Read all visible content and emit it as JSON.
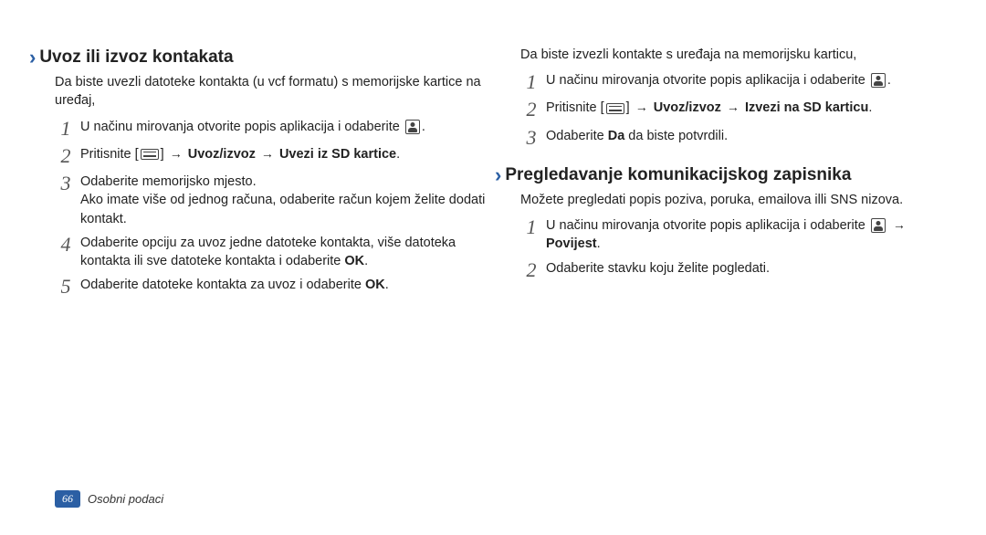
{
  "left": {
    "heading": "Uvoz ili izvoz kontakata",
    "intro": "Da biste uvezli datoteke kontakta (u vcf formatu) s memorijske kartice na uređaj,",
    "steps": [
      {
        "num": "1",
        "parts": [
          {
            "t": "U načinu mirovanja otvorite popis aplikacija i odaberite "
          },
          {
            "icon": "contact"
          },
          {
            "t": "."
          }
        ]
      },
      {
        "num": "2",
        "parts": [
          {
            "t": "Pritisnite ["
          },
          {
            "icon": "menu"
          },
          {
            "t": "] "
          },
          {
            "arrow": true
          },
          {
            "t": " "
          },
          {
            "b": "Uvoz/izvoz"
          },
          {
            "t": " "
          },
          {
            "arrow": true
          },
          {
            "t": " "
          },
          {
            "b": "Uvezi iz SD kartice"
          },
          {
            "t": "."
          }
        ]
      },
      {
        "num": "3",
        "parts": [
          {
            "t": "Odaberite memorijsko mjesto."
          }
        ],
        "sub": "Ako imate više od jednog računa, odaberite račun kojem želite dodati kontakt."
      },
      {
        "num": "4",
        "parts": [
          {
            "t": "Odaberite opciju za uvoz jedne datoteke kontakta, više datoteka kontakta ili sve datoteke kontakta i odaberite "
          },
          {
            "b": "OK"
          },
          {
            "t": "."
          }
        ]
      },
      {
        "num": "5",
        "parts": [
          {
            "t": "Odaberite datoteke kontakta za uvoz i odaberite "
          },
          {
            "b": "OK"
          },
          {
            "t": "."
          }
        ]
      }
    ]
  },
  "right": {
    "intro2": "Da biste izvezli kontakte s uređaja na memorijsku karticu,",
    "steps2": [
      {
        "num": "1",
        "parts": [
          {
            "t": "U načinu mirovanja otvorite popis aplikacija i odaberite "
          },
          {
            "icon": "contact"
          },
          {
            "t": "."
          }
        ]
      },
      {
        "num": "2",
        "parts": [
          {
            "t": "Pritisnite ["
          },
          {
            "icon": "menu"
          },
          {
            "t": "] "
          },
          {
            "arrow": true
          },
          {
            "t": " "
          },
          {
            "b": "Uvoz/izvoz"
          },
          {
            "t": " "
          },
          {
            "arrow": true
          },
          {
            "t": " "
          },
          {
            "b": "Izvezi na SD karticu"
          },
          {
            "t": "."
          }
        ]
      },
      {
        "num": "3",
        "parts": [
          {
            "t": "Odaberite "
          },
          {
            "b": "Da"
          },
          {
            "t": " da biste potvrdili."
          }
        ]
      }
    ],
    "heading2": "Pregledavanje komunikacijskog zapisnika",
    "intro3": "Možete pregledati popis poziva, poruka, emailova illi SNS nizova.",
    "steps3": [
      {
        "num": "1",
        "parts": [
          {
            "t": "U načinu mirovanja otvorite popis aplikacija i odaberite "
          },
          {
            "icon": "contact"
          },
          {
            "t": " "
          },
          {
            "arrow": true
          },
          {
            "t": " "
          },
          {
            "b": "Povijest"
          },
          {
            "t": "."
          }
        ]
      },
      {
        "num": "2",
        "parts": [
          {
            "t": "Odaberite stavku koju želite pogledati."
          }
        ]
      }
    ]
  },
  "footer": {
    "page": "66",
    "title": "Osobni podaci"
  }
}
